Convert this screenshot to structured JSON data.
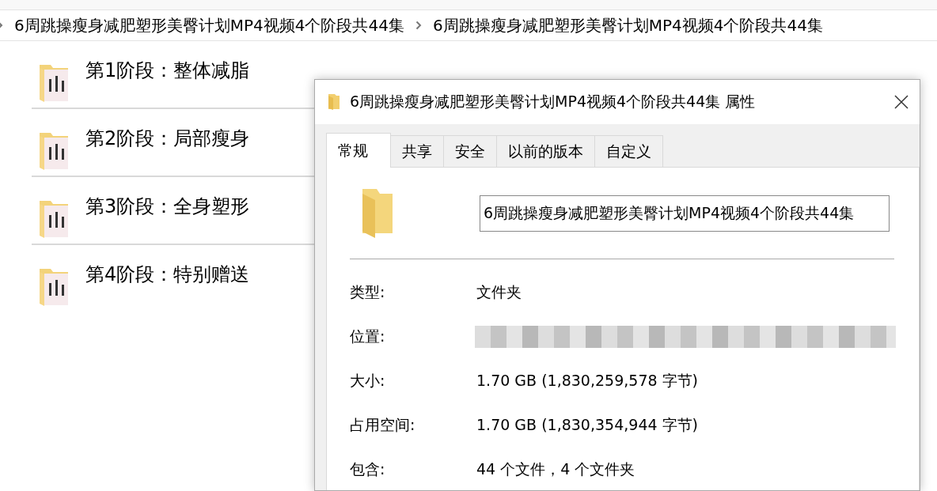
{
  "breadcrumb": [
    {
      "label": "6周跳操瘦身减肥塑形美臀计划MP4视频4个阶段共44集"
    },
    {
      "label": "6周跳操瘦身减肥塑形美臀计划MP4视频4个阶段共44集"
    }
  ],
  "folders": [
    {
      "name": "第1阶段：整体减脂"
    },
    {
      "name": "第2阶段：局部瘦身"
    },
    {
      "name": "第3阶段：全身塑形"
    },
    {
      "name": "第4阶段：特别赠送"
    }
  ],
  "dialog": {
    "title": "6周跳操瘦身减肥塑形美臀计划MP4视频4个阶段共44集 属性",
    "tabs": [
      {
        "label": "常规",
        "selected": true
      },
      {
        "label": "共享",
        "selected": false
      },
      {
        "label": "安全",
        "selected": false
      },
      {
        "label": "以前的版本",
        "selected": false
      },
      {
        "label": "自定义",
        "selected": false
      }
    ],
    "name_field": {
      "value": "6周跳操瘦身减肥塑形美臀计划MP4视频4个阶段共44集"
    },
    "properties": [
      {
        "kind": "text",
        "label": "类型:",
        "value": "文件夹"
      },
      {
        "kind": "blurred",
        "label": "位置:"
      },
      {
        "kind": "text",
        "label": "大小:",
        "value": "1.70 GB (1,830,259,578 字节)"
      },
      {
        "kind": "text",
        "label": "占用空间:",
        "value": "1.70 GB (1,830,354,944 字节)"
      },
      {
        "kind": "text",
        "label": "包含:",
        "value": "44 个文件，4 个文件夹"
      }
    ]
  }
}
